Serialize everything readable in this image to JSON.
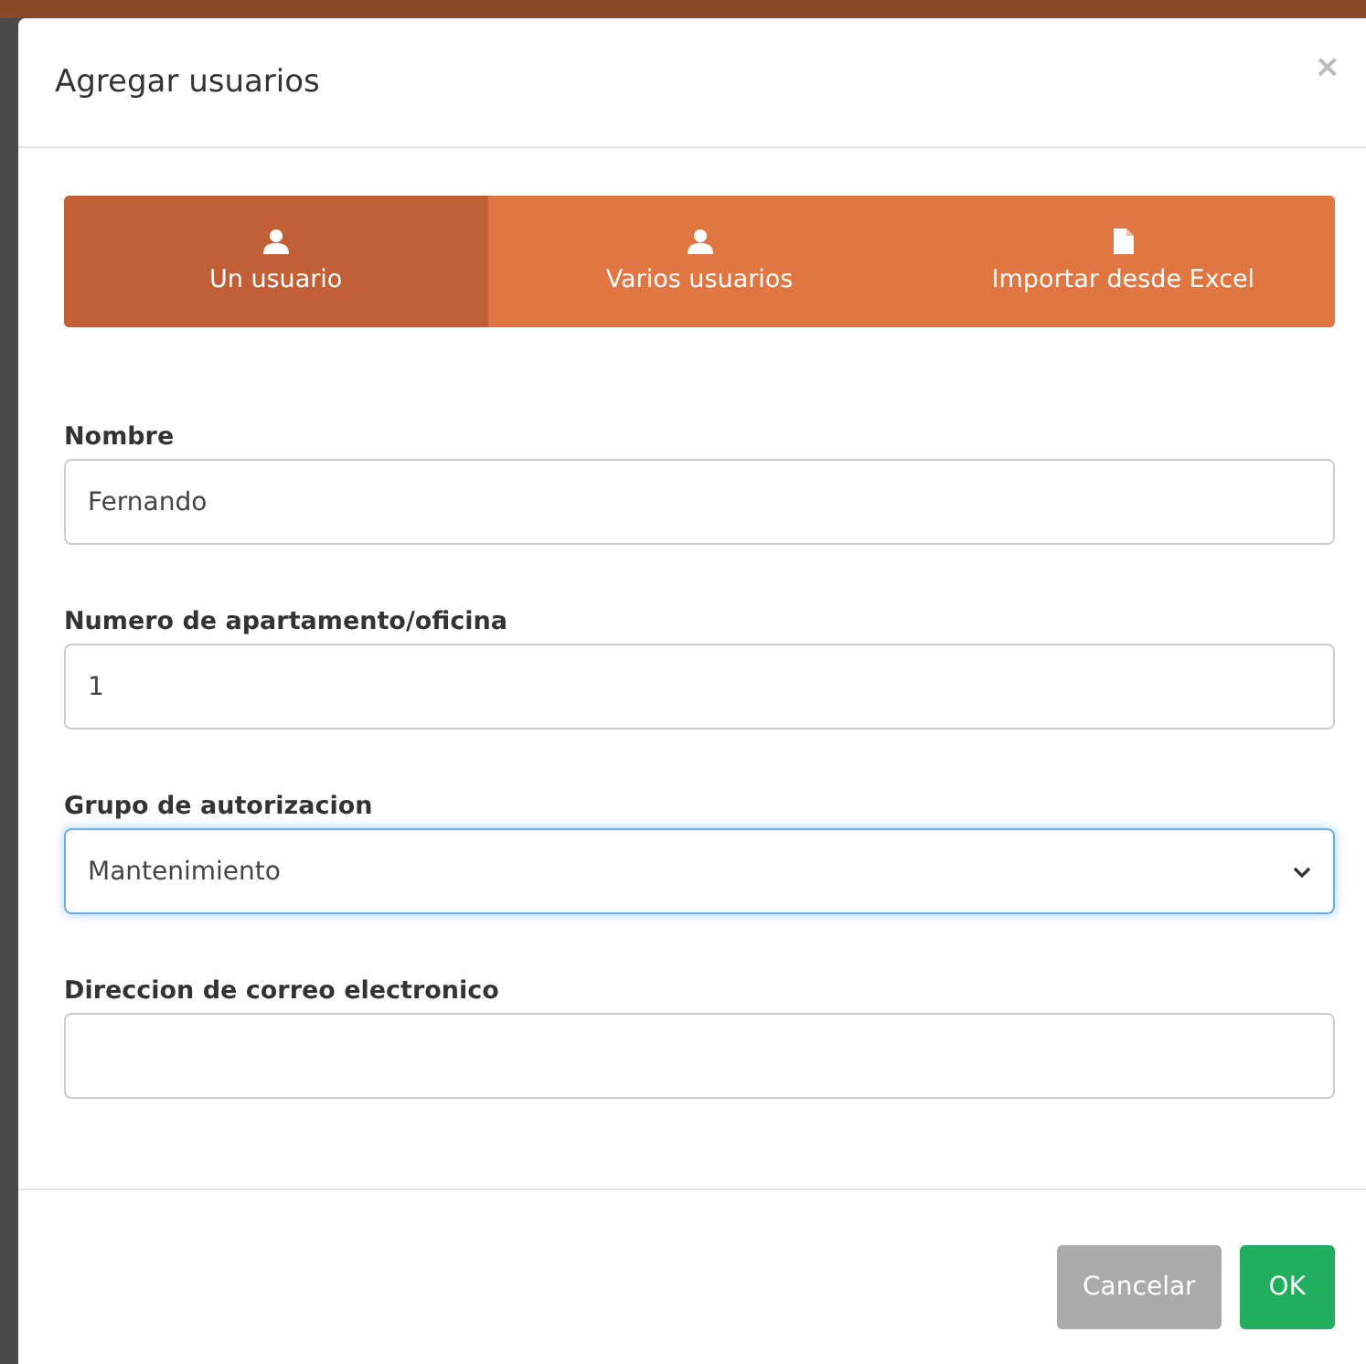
{
  "dialog": {
    "title": "Agregar usuarios",
    "close": "×"
  },
  "tabs": [
    {
      "label": "Un usuario",
      "kind": "user",
      "selected": true
    },
    {
      "label": "Varios usuarios",
      "kind": "user",
      "selected": false
    },
    {
      "label": "Importar desde Excel",
      "kind": "file",
      "selected": false
    }
  ],
  "fields": [
    {
      "label": "Nombre",
      "kind": "text",
      "value": "Fernando",
      "focused": false
    },
    {
      "label": "Numero de apartamento/oficina",
      "kind": "text",
      "value": "1",
      "focused": false
    },
    {
      "label": "Grupo de autorizacion",
      "kind": "select",
      "value": "Mantenimiento",
      "focused": true
    },
    {
      "label": "Direccion de correo electronico",
      "kind": "text",
      "focused": false
    }
  ],
  "buttons": [
    {
      "label": "Cancelar",
      "kind": "secondary"
    },
    {
      "label": "OK",
      "kind": "primary"
    }
  ]
}
